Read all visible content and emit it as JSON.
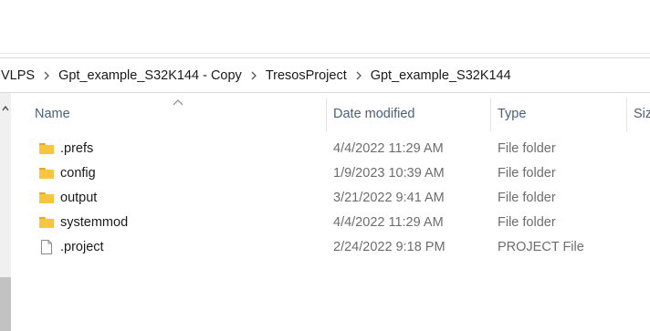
{
  "breadcrumb": [
    "VLPS",
    "Gpt_example_S32K144 - Copy",
    "TresosProject",
    "Gpt_example_S32K144"
  ],
  "columns": {
    "name": "Name",
    "date_modified": "Date modified",
    "type": "Type",
    "size": "Siz"
  },
  "files": [
    {
      "name": ".prefs",
      "date": "4/4/2022 11:29 AM",
      "type": "File folder",
      "icon": "folder-icon"
    },
    {
      "name": "config",
      "date": "1/9/2023 10:39 AM",
      "type": "File folder",
      "icon": "folder-icon"
    },
    {
      "name": "output",
      "date": "3/21/2022 9:41 AM",
      "type": "File folder",
      "icon": "folder-icon"
    },
    {
      "name": "systemmod",
      "date": "4/4/2022 11:29 AM",
      "type": "File folder",
      "icon": "folder-icon"
    },
    {
      "name": ".project",
      "date": "2/24/2022 9:18 PM",
      "type": "PROJECT File",
      "icon": "file-icon"
    }
  ],
  "colors": {
    "folder": "#f8c63d",
    "header_text": "#4c607a",
    "secondary_text": "#6d6d6d"
  }
}
